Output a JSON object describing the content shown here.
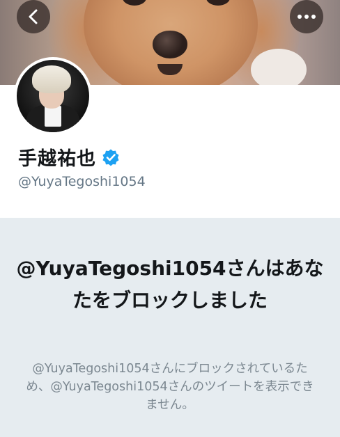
{
  "profile": {
    "display_name": "手越祐也",
    "handle": "@YuyaTegoshi1054",
    "verified": true,
    "verified_color": "#1da1f2"
  },
  "header": {
    "back_icon": "chevron-left-icon",
    "more_icon": "more-horizontal-icon"
  },
  "blocked": {
    "title": "@YuyaTegoshi1054さんはあなたをブロックしました",
    "description": "@YuyaTegoshi1054さんにブロックされているため、@YuyaTegoshi1054さんのツイートを表示できません。"
  },
  "colors": {
    "panel_background": "#e6ecf0",
    "title_text": "#14171a",
    "secondary_text": "#657786"
  }
}
